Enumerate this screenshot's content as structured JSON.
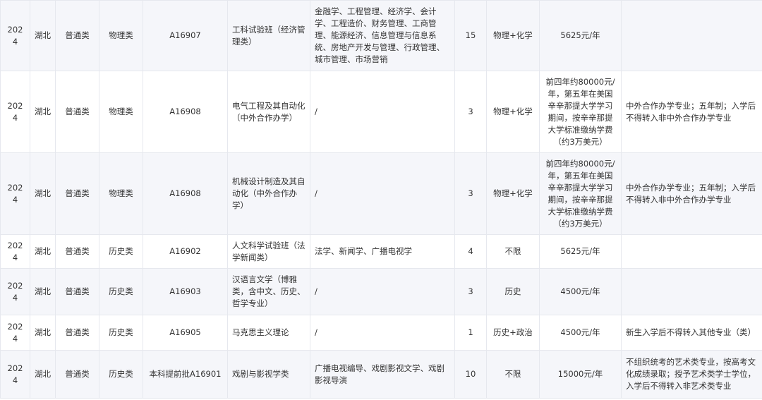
{
  "rows": [
    {
      "year": "2024",
      "province": "湖北",
      "category": "普通类",
      "subject": "物理类",
      "code": "A16907",
      "major": "工科试验班（经济管理类）",
      "includes": "金融学、工程管理、经济学、会计学、工程造价、财务管理、工商管理、能源经济、信息管理与信息系统、房地产开发与管理、行政管理、城市管理、市场营销",
      "plan": "15",
      "requirement": "物理+化学",
      "tuition": "5625元/年",
      "notes": ""
    },
    {
      "year": "2024",
      "province": "湖北",
      "category": "普通类",
      "subject": "物理类",
      "code": "A16908",
      "major": "电气工程及其自动化（中外合作办学）",
      "includes": "/",
      "plan": "3",
      "requirement": "物理+化学",
      "tuition": "前四年约80000元/年，第五年在美国辛辛那提大学学习期间，按辛辛那提大学标准缴纳学费（约3万美元）",
      "notes": "中外合作办学专业；五年制；入学后不得转入非中外合作办学专业"
    },
    {
      "year": "2024",
      "province": "湖北",
      "category": "普通类",
      "subject": "物理类",
      "code": "A16908",
      "major": "机械设计制造及其自动化（中外合作办学）",
      "includes": "/",
      "plan": "3",
      "requirement": "物理+化学",
      "tuition": "前四年约80000元/年，第五年在美国辛辛那提大学学习期间，按辛辛那提大学标准缴纳学费（约3万美元）",
      "notes": "中外合作办学专业；五年制；入学后不得转入非中外合作办学专业"
    },
    {
      "year": "2024",
      "province": "湖北",
      "category": "普通类",
      "subject": "历史类",
      "code": "A16902",
      "major": "人文科学试验班（法学新闻类）",
      "includes": "法学、新闻学、广播电视学",
      "plan": "4",
      "requirement": "不限",
      "tuition": "5625元/年",
      "notes": ""
    },
    {
      "year": "2024",
      "province": "湖北",
      "category": "普通类",
      "subject": "历史类",
      "code": "A16903",
      "major": "汉语言文学（博雅类，含中文、历史、哲学专业）",
      "includes": "/",
      "plan": "3",
      "requirement": "历史",
      "tuition": "4500元/年",
      "notes": ""
    },
    {
      "year": "2024",
      "province": "湖北",
      "category": "普通类",
      "subject": "历史类",
      "code": "A16905",
      "major": "马克思主义理论",
      "includes": "/",
      "plan": "1",
      "requirement": "历史+政治",
      "tuition": "4500元/年",
      "notes": "新生入学后不得转入其他专业（类）"
    },
    {
      "year": "2024",
      "province": "湖北",
      "category": "普通类",
      "subject": "历史类",
      "code": "本科提前批A16901",
      "major": "戏剧与影视学类",
      "includes": "广播电视编导、戏剧影视文学、戏剧影视导演",
      "plan": "10",
      "requirement": "不限",
      "tuition": "15000元/年",
      "notes": "不组织统考的艺术类专业，按高考文化成绩录取；授予艺术类学士学位，入学后不得转入非艺术类专业"
    }
  ]
}
